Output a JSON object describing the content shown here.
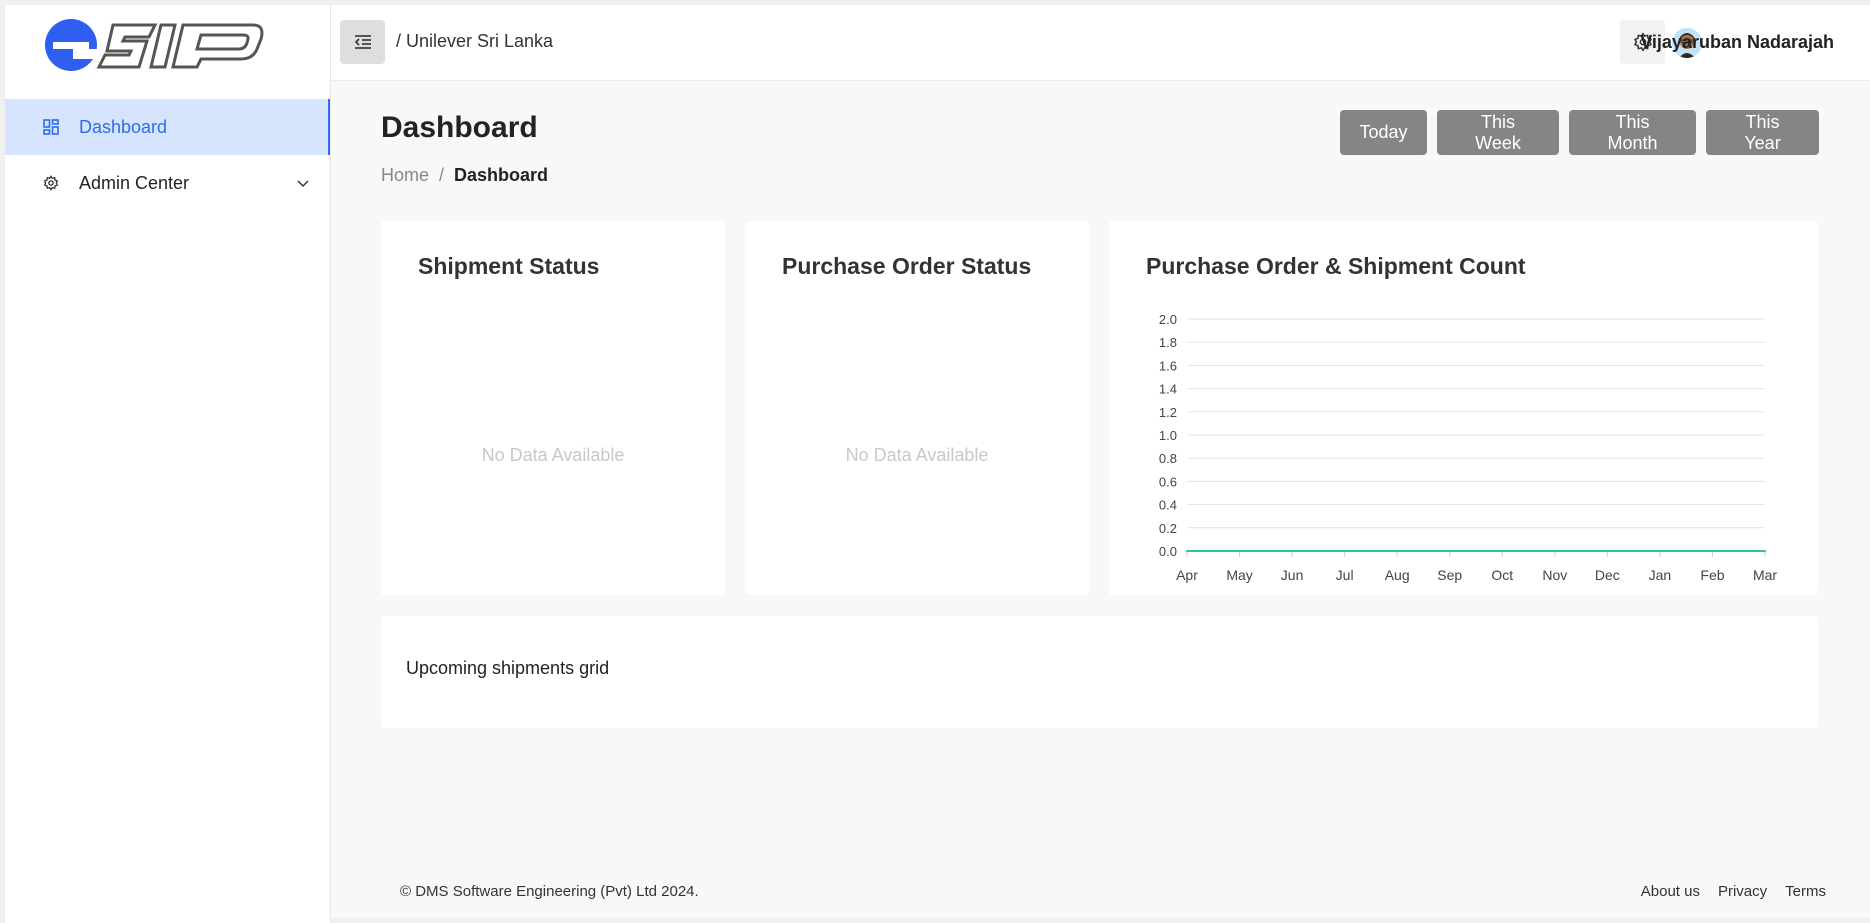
{
  "sidebar": {
    "items": [
      {
        "label": "Dashboard",
        "icon": "dashboard-icon",
        "active": true
      },
      {
        "label": "Admin Center",
        "icon": "gear-icon",
        "active": false
      }
    ]
  },
  "header": {
    "breadcrumb": "/ Unilever Sri Lanka",
    "user_name": "Vijayaruban Nadarajah"
  },
  "page": {
    "title": "Dashboard",
    "breadcrumb_home": "Home",
    "breadcrumb_sep": "/",
    "breadcrumb_current": "Dashboard",
    "periods": [
      "Today",
      "This Week",
      "This Month",
      "This Year"
    ]
  },
  "cards": {
    "shipment_status": {
      "title": "Shipment Status",
      "empty": "No Data Available"
    },
    "po_status": {
      "title": "Purchase Order Status",
      "empty": "No Data Available"
    },
    "count": {
      "title": "Purchase Order & Shipment Count"
    }
  },
  "grid": {
    "label": "Upcoming shipments grid"
  },
  "footer": {
    "copyright": "© DMS Software Engineering (Pvt) Ltd 2024.",
    "links": [
      "About us",
      "Privacy",
      "Terms"
    ]
  },
  "colors": {
    "accent": "#2f6bf0",
    "line": "#2bc4a0",
    "button": "#858585"
  },
  "chart_data": {
    "type": "line",
    "title": "Purchase Order & Shipment Count",
    "categories": [
      "Apr",
      "May",
      "Jun",
      "Jul",
      "Aug",
      "Sep",
      "Oct",
      "Nov",
      "Dec",
      "Jan",
      "Feb",
      "Mar"
    ],
    "series": [
      {
        "values": [
          0,
          0,
          0,
          0,
          0,
          0,
          0,
          0,
          0,
          0,
          0,
          0
        ]
      }
    ],
    "yticks": [
      "2.0",
      "1.8",
      "1.6",
      "1.4",
      "1.2",
      "1.0",
      "0.8",
      "0.6",
      "0.4",
      "0.2",
      "0.0"
    ],
    "ylim": [
      0,
      2
    ],
    "grid": true
  }
}
